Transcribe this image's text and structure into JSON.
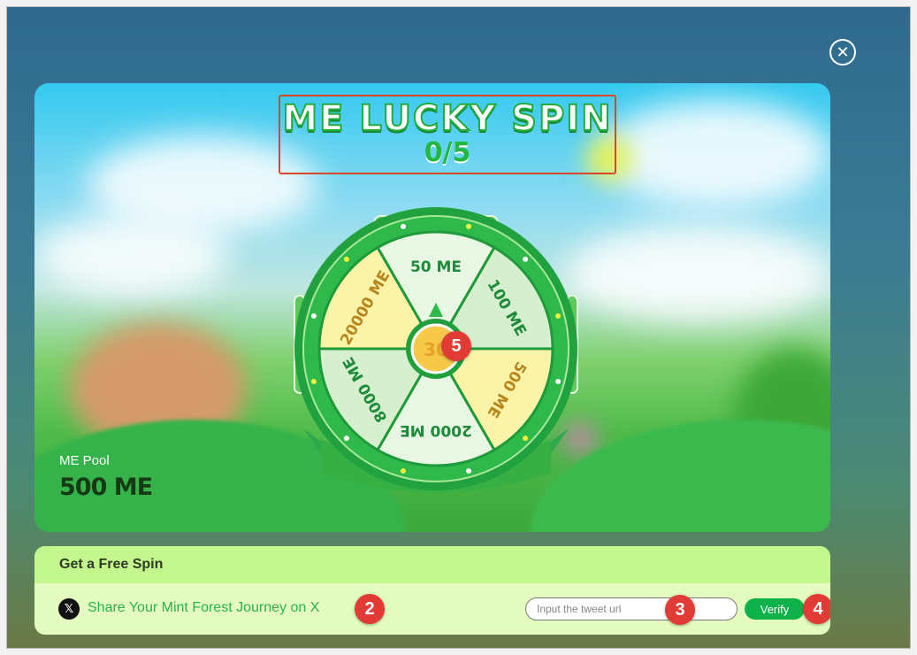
{
  "modal": {
    "close_icon": "close-icon",
    "title": "ME LUCKY SPIN",
    "spin_count": "0/5",
    "pool": {
      "label": "ME Pool",
      "value": "500 ME"
    }
  },
  "wheel": {
    "segments": [
      {
        "label": "50 ME",
        "color": "#e8f7e4"
      },
      {
        "label": "100 ME",
        "color": "#d6f0cf"
      },
      {
        "label": "500 ME",
        "color": "#fbf4a8"
      },
      {
        "label": "2000 ME",
        "color": "#e8f7e4"
      },
      {
        "label": "8000 ME",
        "color": "#d6f0cf"
      },
      {
        "label": "20000 ME",
        "color": "#fbf4a8"
      }
    ],
    "center_label": "30"
  },
  "free_spin": {
    "header": "Get a Free Spin",
    "task": {
      "icon": "x-logo-icon",
      "icon_glyph": "𝕏",
      "label": "Share Your Mint Forest Journey on X",
      "input_value": "",
      "input_placeholder": "Input the tweet url",
      "verify_label": "Verify"
    }
  },
  "badges": {
    "task_link": "2",
    "tweet_input": "3",
    "verify": "4",
    "wheel_center": "5"
  },
  "colors": {
    "accent_green": "#0fb24a",
    "link_green": "#2bb24c",
    "badge_red": "#e23a35",
    "title_stroke": "#1fae3d"
  }
}
